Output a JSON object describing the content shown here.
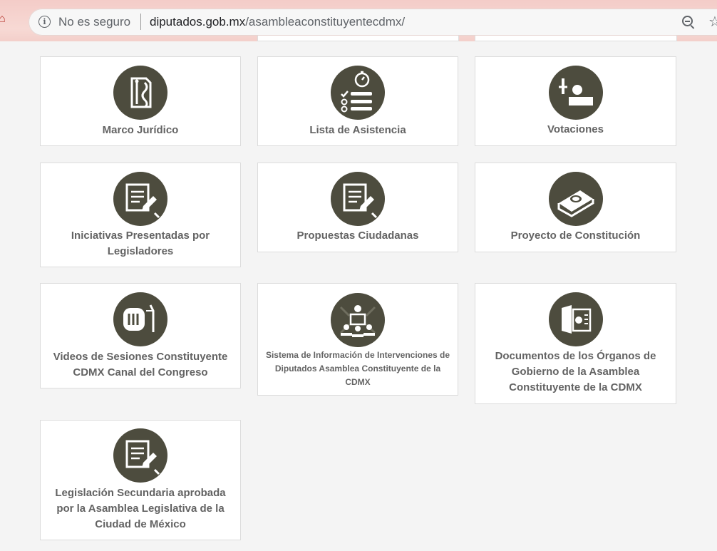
{
  "browser": {
    "not_secure": "No es seguro",
    "url_domain": "diputados.gob.mx",
    "url_path": "/asambleaconstituyentecdmx/"
  },
  "cards": [
    {
      "label": "Marco Jurídico",
      "icon": "gavel-document-icon"
    },
    {
      "label": "Lista de Asistencia",
      "icon": "stopwatch-checklist-icon"
    },
    {
      "label": "Votaciones",
      "icon": "voting-person-icon"
    },
    {
      "label": "Iniciativas Presentadas por Legisladores",
      "icon": "document-pen-icon"
    },
    {
      "label": "Propuestas Ciudadanas",
      "icon": "document-pen-icon"
    },
    {
      "label": "Proyecto de Constitución",
      "icon": "constitution-book-icon"
    },
    {
      "label": "Videos de Sesiones Constituyente CDMX Canal del Congreso",
      "icon": "video-columns-icon"
    },
    {
      "label": "Sistema de Información de Intervenciones de Diputados Asamblea Constituyente de la CDMX",
      "icon": "assembly-podium-icon"
    },
    {
      "label": "Documentos de los Órganos de Gobierno de la Asamblea Constituyente de la CDMX",
      "icon": "open-folder-seal-icon"
    },
    {
      "label": "Legislación Secundaria aprobada por la Asamblea Legislativa de la Ciudad de México",
      "icon": "document-pen-icon"
    }
  ],
  "colors": {
    "icon_bg": "#4d4c3e",
    "card_text": "#636363",
    "page_bg": "#f4f4f4"
  }
}
